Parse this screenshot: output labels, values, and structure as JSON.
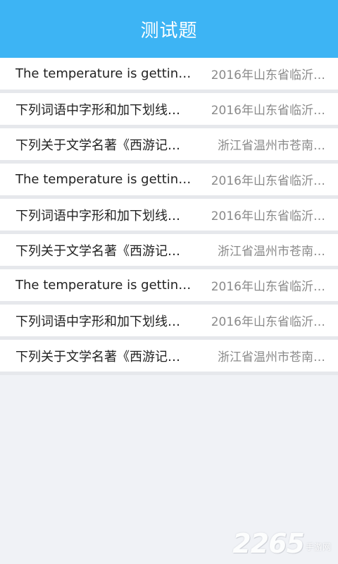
{
  "header": {
    "title": "测试题"
  },
  "questions": [
    {
      "title": "The temperature is getting hi…",
      "source": "2016年山东省临沂…"
    },
    {
      "title": "下列词语中字形和加下划线…",
      "source": "2016年山东省临沂…"
    },
    {
      "title": "下列关于文学名著《西游记…",
      "source": "浙江省温州市苍南…"
    },
    {
      "title": "The temperature is getting hi…",
      "source": "2016年山东省临沂…"
    },
    {
      "title": "下列词语中字形和加下划线…",
      "source": "2016年山东省临沂…"
    },
    {
      "title": "下列关于文学名著《西游记…",
      "source": "浙江省温州市苍南…"
    },
    {
      "title": "The temperature is getting hi…",
      "source": "2016年山东省临沂…"
    },
    {
      "title": "下列词语中字形和加下划线…",
      "source": "2016年山东省临沂…"
    },
    {
      "title": "下列关于文学名著《西游记…",
      "source": "浙江省温州市苍南…"
    }
  ],
  "watermark": {
    "number": "2265",
    "suffix": "手游网"
  },
  "colors": {
    "header_bg": "#3db4f4",
    "page_bg": "#f0f2f6",
    "title_text": "#222222",
    "source_text": "#8a8a8a"
  }
}
